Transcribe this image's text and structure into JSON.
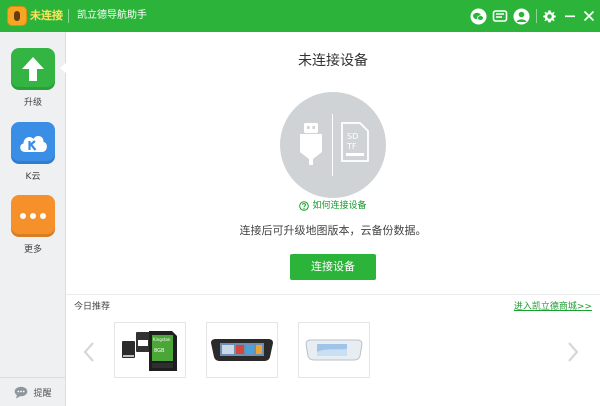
{
  "titlebar": {
    "status": "未连接",
    "app_name": "凯立德导航助手"
  },
  "sidebar": {
    "items": [
      {
        "label": "升级",
        "icon": "upgrade-arrow-icon"
      },
      {
        "label": "K云",
        "icon": "k-cloud-icon"
      },
      {
        "label": "更多",
        "icon": "more-dots-icon"
      }
    ],
    "feedback_label": "提醒"
  },
  "main": {
    "title": "未连接设备",
    "device_labels": {
      "sd": "SD",
      "tf": "TF"
    },
    "help_link": "如何连接设备",
    "description": "连接后可升级地图版本，云备份数据。",
    "connect_button": "连接设备"
  },
  "recommend": {
    "title": "今日推荐",
    "store_link": "进入凯立德商城>>",
    "sd_card_brand": "Kingston",
    "sd_card_capacity": "8GB",
    "products": [
      {
        "name": "sd-card-product"
      },
      {
        "name": "dashcam-product"
      },
      {
        "name": "mirror-dashcam-product"
      }
    ]
  },
  "colors": {
    "brand_green": "#2cb43a",
    "status_yellow": "#ffe35c",
    "link_green": "#1a9d2e"
  }
}
